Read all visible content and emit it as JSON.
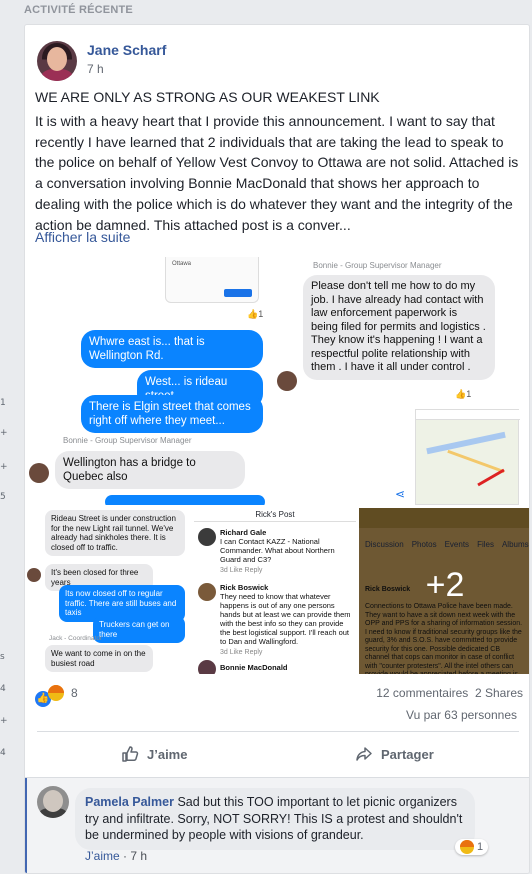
{
  "section": {
    "title": "ACTIVITÉ RÉCENTE"
  },
  "left_strip_ticks": [
    "1",
    "+",
    "+",
    "5",
    "s",
    "4",
    "+",
    "4"
  ],
  "post": {
    "author": "Jane Scharf",
    "time": "7 h",
    "title": "WE ARE ONLY AS STRONG AS OUR WEAKEST LINK",
    "body": "It is with a heavy heart that I provide this announcement. I want to say that recently I have learned that 2 individuals that are taking the lead to speak to the police on behalf of Yellow Vest Convoy to Ottawa are not solid. Attached is a conversation involving Bonnie MacDonald that shows her approach to dealing with the police which is do whatever they want and the integrity of the action be damned. This attached post is a conver...",
    "see_more": "Afficher la suite"
  },
  "photo1": {
    "bubble_blue_1": "Whwre east is... that is Wellington Rd.",
    "bubble_blue_2": "West... is rideau street",
    "bubble_blue_3": "There is Elgin street that comes right off where they meet...",
    "sender": "Bonnie - Group Supervisor Manager",
    "bubble_gray": "Wellington has a bridge to Quebec also",
    "map_label": "Ottawa",
    "like_count": "1"
  },
  "photo2": {
    "sender": "Bonnie - Group Supervisor Manager",
    "bubble_gray": "Please don't tell me how to do my job.  I have already had contact with law enforcement paperwork is being filed for permits and logistics .  They know it's happening !  I want a respectful polite relationship with them .  I have it all under control .",
    "like_count": "1"
  },
  "photo3": {
    "bubble_gray_1": "Rideau Street is under construction for the new Light rail tunnel.  We've already had sinkholes there.  It is closed off to traffic.",
    "bubble_gray_2": "It's been closed for three years",
    "bubble_blue_1": "Its now closed off to regular traffic.  There are still buses and taxis",
    "bubble_blue_2": "Truckers can get on there",
    "sender": "Jack - Coordinator",
    "bubble_gray_3": "We want to come in on the busiest road"
  },
  "photo4": {
    "header": "Rick's Post",
    "c1_name": "Richard Gale",
    "c1_text": "I can Contact KAZZ - National Commander.  What about Northern Guard and C3?",
    "c1_meta": "3d   Like   Reply",
    "c2_name": "Rick Boswick",
    "c2_text": "They need to know that whatever happens is out of any one persons hands but at least we can provide them with the best info so they can provide the best  logistical support. I'll reach out to Dan and Wallingford.",
    "c2_meta": "3d   Like   Reply",
    "c3_name": "Bonnie MacDonald"
  },
  "photo5": {
    "more": "+2",
    "tabs": [
      "Discussion",
      "Photos",
      "Events",
      "Files",
      "Albums"
    ],
    "author": "Rick Boswick",
    "text": "Connections to Ottawa Police have been made. They want to have a sit down next week with the OPP and PPS for a sharing of information session. I need to know if traditional security groups like the guard, 3% and S.O.S. have committed to provide security for this one. Possible dedicated CB channel that cops can monitor in case of conflict with \"counter protesters\". All the intel others can provide would be appreciated before a meeting is set."
  },
  "stats": {
    "reaction_count": "8",
    "comments": "12 commentaires",
    "shares": "2 Shares",
    "views": "Vu par 63 personnes"
  },
  "actions": {
    "like": "J’aime",
    "share": "Partager"
  },
  "comment": {
    "author": "Pamela Palmer",
    "text": "Sad but this TOO important to let picnic organizers try and infiltrate. Sorry, NOT SORRY! This IS a protest and shouldn't be undermined by people with visions of grandeur.",
    "like_link": "J’aime",
    "time": "7 h",
    "reaction_count": "1"
  },
  "colors": {
    "link": "#365899",
    "messenger_blue": "#0a84ff",
    "like_blue": "#2078f4",
    "background": "#e9ebee"
  }
}
